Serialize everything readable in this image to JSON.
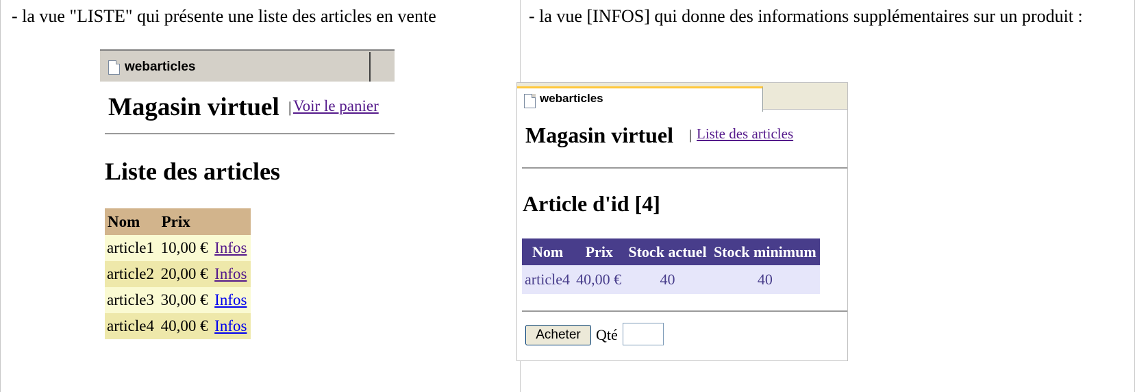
{
  "left": {
    "caption": "- la vue \"LISTE\" qui présente une liste des articles en vente",
    "browser": {
      "tab_title": "webarticles",
      "site_title": "Magasin virtuel",
      "separator": "|",
      "nav_link": "Voir le panier",
      "heading": "Liste des articles",
      "table": {
        "headers": [
          "Nom",
          "Prix"
        ],
        "rows": [
          {
            "nom": "article1",
            "prix": "10,00 €",
            "link": "Infos"
          },
          {
            "nom": "article2",
            "prix": "20,00 €",
            "link": "Infos"
          },
          {
            "nom": "article3",
            "prix": "30,00 €",
            "link": "Infos"
          },
          {
            "nom": "article4",
            "prix": "40,00 €",
            "link": "Infos"
          }
        ]
      }
    }
  },
  "right": {
    "caption": "- la vue [INFOS] qui donne des informations supplémentaires sur un produit :",
    "browser": {
      "tab_title": "webarticles",
      "site_title": "Magasin virtuel",
      "separator": "|",
      "nav_link": "Liste des articles",
      "heading": "Article d'id [4]",
      "table": {
        "headers": [
          "Nom",
          "Prix",
          "Stock actuel",
          "Stock minimum"
        ],
        "row": {
          "nom": "article4",
          "prix": "40,00 €",
          "stock_actuel": "40",
          "stock_minimum": "40"
        }
      },
      "buy_button": "Acheter",
      "qty_label": "Qté",
      "qty_value": ""
    }
  }
}
